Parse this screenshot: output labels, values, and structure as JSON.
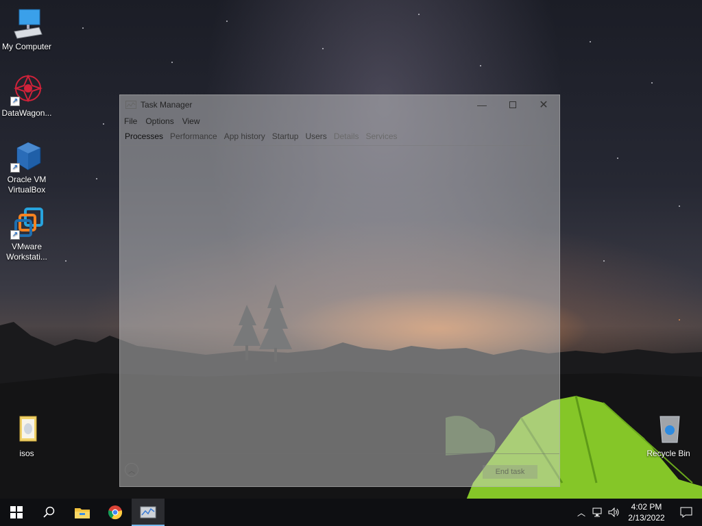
{
  "desktop": {
    "icons": [
      {
        "label": "My Computer"
      },
      {
        "label": "DataWagon..."
      },
      {
        "label": "Oracle VM VirtualBox"
      },
      {
        "label": "VMware Workstati..."
      },
      {
        "label": "isos"
      },
      {
        "label": "Recycle Bin"
      }
    ]
  },
  "task_manager": {
    "title": "Task Manager",
    "menu": [
      "File",
      "Options",
      "View"
    ],
    "tabs": [
      "Processes",
      "Performance",
      "App history",
      "Startup",
      "Users",
      "Details",
      "Services"
    ],
    "end_task_label": "End task"
  },
  "taskbar": {
    "clock_time": "4:02 PM",
    "clock_date": "2/13/2022"
  },
  "colors": {
    "taskbar_bg": "#0e0f12",
    "active_indicator": "#76b9ed",
    "tent_green": "#8fd62a"
  }
}
